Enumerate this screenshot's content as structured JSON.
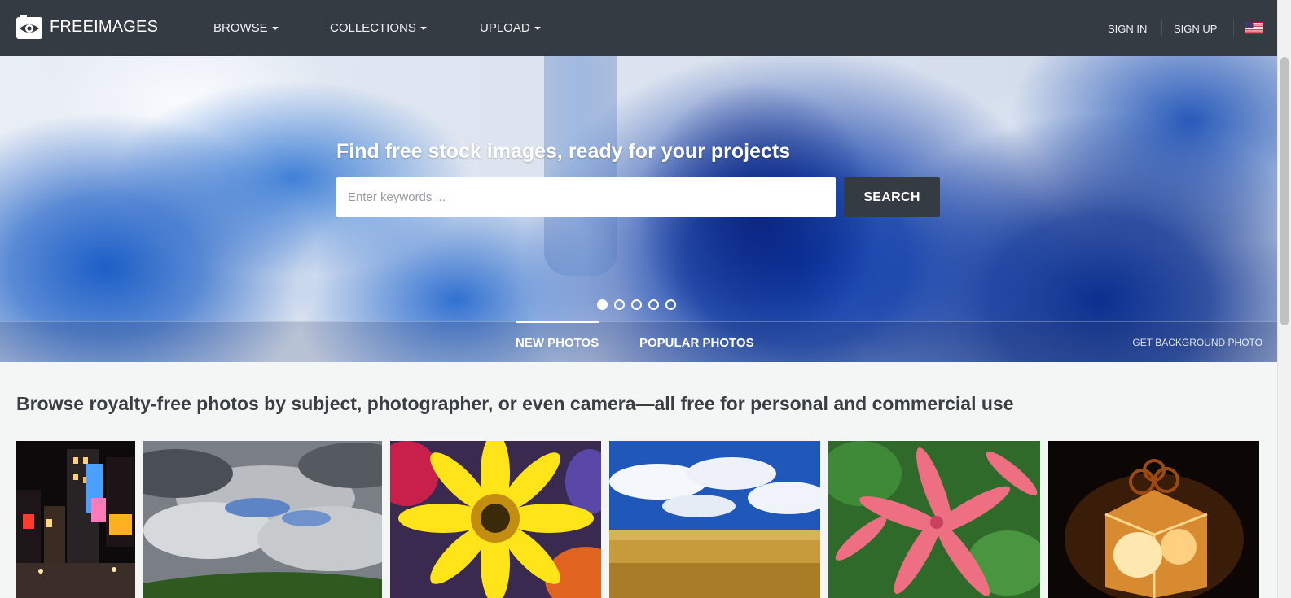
{
  "navbar": {
    "logo_text": "FREEIMAGES",
    "menu": [
      {
        "label": "BROWSE"
      },
      {
        "label": "COLLECTIONS"
      },
      {
        "label": "UPLOAD"
      }
    ],
    "sign_in": "SIGN IN",
    "sign_up": "SIGN UP",
    "language_icon": "us-flag-icon"
  },
  "hero": {
    "title": "Find free stock images, ready for your projects",
    "search": {
      "placeholder": "Enter keywords ...",
      "value": "",
      "button_label": "SEARCH"
    },
    "slides_count": 5,
    "active_slide": 1,
    "tabs": [
      {
        "label": "NEW PHOTOS",
        "active": true
      },
      {
        "label": "POPULAR PHOTOS",
        "active": false
      }
    ],
    "get_background": "GET BACKGROUND PHOTO"
  },
  "main": {
    "tagline": "Browse royalty-free photos by subject, photographer, or even camera—all free for personal and commercial use",
    "thumbnails": [
      {
        "subject": "night-city-street"
      },
      {
        "subject": "cloudy-sky-over-hill"
      },
      {
        "subject": "yellow-gerbera-flower"
      },
      {
        "subject": "blue-sky-over-wheat-field"
      },
      {
        "subject": "pink-leaves-plant"
      },
      {
        "subject": "glowing-gift-box"
      }
    ]
  },
  "colors": {
    "navbar_bg": "#353b43",
    "search_button_bg": "#353b43",
    "page_bg": "#f4f6f5",
    "tagline_text": "#3a3f44"
  }
}
